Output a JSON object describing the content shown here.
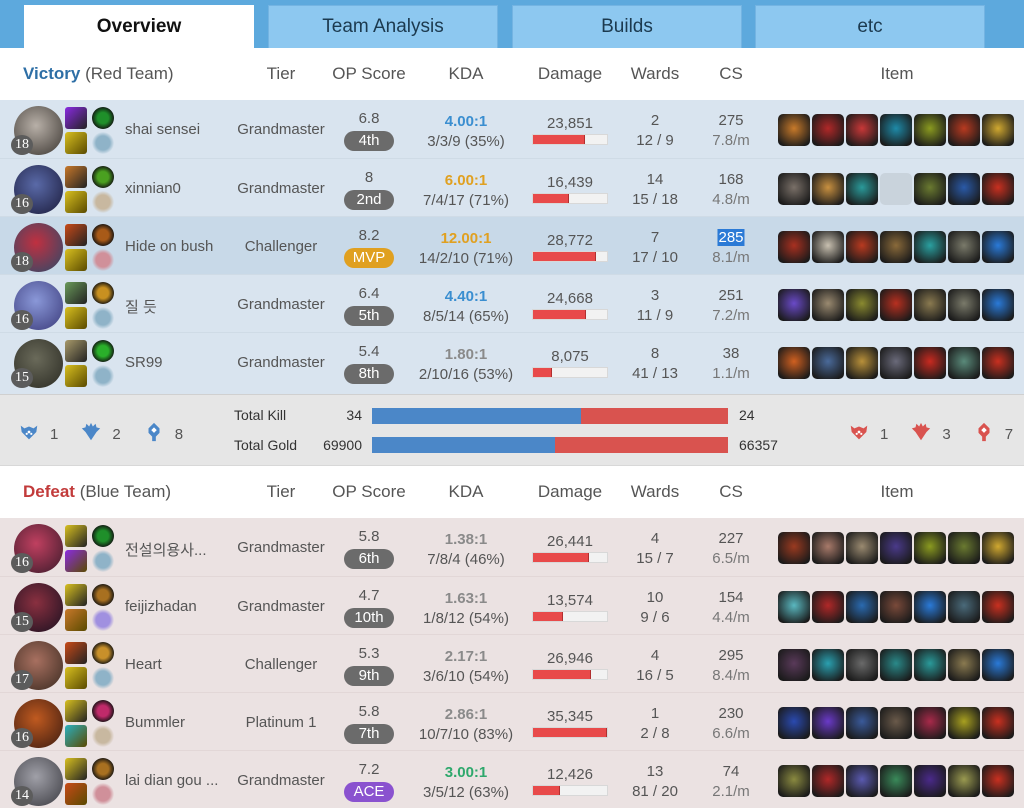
{
  "tabs": [
    {
      "label": "Overview",
      "active": true
    },
    {
      "label": "Team Analysis",
      "active": false
    },
    {
      "label": "Builds",
      "active": false
    },
    {
      "label": "etc",
      "active": false
    }
  ],
  "columns": {
    "tier": "Tier",
    "op_score": "OP Score",
    "kda": "KDA",
    "damage": "Damage",
    "wards": "Wards",
    "cs": "CS",
    "item": "Item"
  },
  "colors": {
    "victory": "#2e6fa6",
    "defeat": "#c23b3b",
    "kda_blue": "#3a8ed0",
    "kda_orange": "#e0a020",
    "kda_green": "#2ea86c",
    "kda_gray": "#8a8a8a",
    "damage_bar": "#e84a4a",
    "mvp": "#e0a020",
    "ace": "#8a52cf",
    "rank": "#6b6b6b",
    "blue_team": "#4b87c8",
    "red_team": "#d9534f"
  },
  "teams": [
    {
      "result": "Victory",
      "team_name": "(Red Team)",
      "players": [
        {
          "name": "shai sensei",
          "level": "18",
          "tier": "Grandmaster",
          "op_score": "6.8",
          "rank": "4th",
          "rank_type": "normal",
          "kda_ratio": "4.00:1",
          "kda_color": "blue",
          "kda_detail": "3/3/9 (35%)",
          "damage": "23,851",
          "damage_fraction": 0.7,
          "wards_placed": "2",
          "wards_detail": "12 / 9",
          "cs": "275",
          "cs_per_min": "7.8/m",
          "highlighted": false,
          "cs_selected": false,
          "avatar_colors": [
            "#b8b0a8",
            "#3a3530"
          ],
          "spells": [
            "#8a2be2",
            "#d8c020"
          ],
          "runes": [
            "#1f8f2a",
            "#8fb3c8"
          ],
          "items": [
            "#c87a2a",
            "#b02828",
            "#c83838",
            "#1e8aa8",
            "#8a9a20",
            "#b83a20",
            "#d0a830"
          ]
        },
        {
          "name": "xinnian0",
          "level": "16",
          "tier": "Grandmaster",
          "op_score": "8",
          "rank": "2nd",
          "rank_type": "normal",
          "kda_ratio": "6.00:1",
          "kda_color": "orange",
          "kda_detail": "7/4/17 (71%)",
          "damage": "16,439",
          "damage_fraction": 0.48,
          "wards_placed": "14",
          "wards_detail": "15 / 18",
          "cs": "168",
          "cs_per_min": "4.8/m",
          "highlighted": false,
          "cs_selected": false,
          "avatar_colors": [
            "#5a6aa8",
            "#1a1a3a"
          ],
          "spells": [
            "#c8782a",
            "#d8c020"
          ],
          "runes": [
            "#4aa020",
            "#c8b8a0"
          ],
          "items": [
            "#7a7068",
            "#c89040",
            "#2a9a9a",
            null,
            "#6a7a30",
            "#2a5aa8",
            "#c83020"
          ]
        },
        {
          "name": "Hide on bush",
          "level": "18",
          "tier": "Challenger",
          "op_score": "8.2",
          "rank": "MVP",
          "rank_type": "mvp",
          "kda_ratio": "12.00:1",
          "kda_color": "orange",
          "kda_detail": "14/2/10 (71%)",
          "damage": "28,772",
          "damage_fraction": 0.85,
          "wards_placed": "7",
          "wards_detail": "17 / 10",
          "cs": "285",
          "cs_per_min": "8.1/m",
          "highlighted": true,
          "cs_selected": true,
          "avatar_colors": [
            "#c03040",
            "#2a4a6a"
          ],
          "spells": [
            "#c84a18",
            "#d8c020"
          ],
          "runes": [
            "#a85a18",
            "#d0909a"
          ],
          "items": [
            "#a83020",
            "#c8c0b0",
            "#b83a20",
            "#8a6a3a",
            "#2aa0a0",
            "#7a7a6a",
            "#2a7ad8"
          ]
        },
        {
          "name": "질 듯",
          "level": "16",
          "tier": "Grandmaster",
          "op_score": "6.4",
          "rank": "5th",
          "rank_type": "normal",
          "kda_ratio": "4.40:1",
          "kda_color": "blue",
          "kda_detail": "8/5/14 (65%)",
          "damage": "24,668",
          "damage_fraction": 0.72,
          "wards_placed": "3",
          "wards_detail": "11 / 9",
          "cs": "251",
          "cs_per_min": "7.2/m",
          "highlighted": false,
          "cs_selected": false,
          "avatar_colors": [
            "#8a98d8",
            "#3a3a7a"
          ],
          "spells": [
            "#6a9a5a",
            "#d8c020"
          ],
          "runes": [
            "#c89020",
            "#8fb3c8"
          ],
          "items": [
            "#6a4ac8",
            "#9a8a70",
            "#8a8a30",
            "#b83020",
            "#8a7a50",
            "#7a7a6a",
            "#2a7ad8"
          ]
        },
        {
          "name": "SR99",
          "level": "15",
          "tier": "Grandmaster",
          "op_score": "5.4",
          "rank": "8th",
          "rank_type": "normal",
          "kda_ratio": "1.80:1",
          "kda_color": "gray",
          "kda_detail": "2/10/16 (53%)",
          "damage": "8,075",
          "damage_fraction": 0.25,
          "wards_placed": "8",
          "wards_detail": "41 / 13",
          "cs": "38",
          "cs_per_min": "1.1/m",
          "highlighted": false,
          "cs_selected": false,
          "avatar_colors": [
            "#6a6a5a",
            "#2a2a22"
          ],
          "spells": [
            "#a89a6a",
            "#d8c020"
          ],
          "runes": [
            "#2ab02a",
            "#8fb3c8"
          ],
          "items": [
            "#d06020",
            "#4a6a9a",
            "#b8903a",
            "#6a6a7a",
            "#c82a20",
            "#5a8a7a",
            "#c83020"
          ]
        }
      ],
      "objectives": [
        {
          "icon": "baron-icon",
          "count": "1"
        },
        {
          "icon": "dragon-icon",
          "count": "2"
        },
        {
          "icon": "tower-icon",
          "count": "8"
        }
      ]
    },
    {
      "result": "Defeat",
      "team_name": "(Blue Team)",
      "players": [
        {
          "name": "전설의용사...",
          "level": "16",
          "tier": "Grandmaster",
          "op_score": "5.8",
          "rank": "6th",
          "rank_type": "normal",
          "kda_ratio": "1.38:1",
          "kda_color": "gray",
          "kda_detail": "7/8/4 (46%)",
          "damage": "26,441",
          "damage_fraction": 0.76,
          "wards_placed": "4",
          "wards_detail": "15 / 7",
          "cs": "227",
          "cs_per_min": "6.5/m",
          "highlighted": false,
          "cs_selected": false,
          "avatar_colors": [
            "#c04060",
            "#3a1a2a"
          ],
          "spells": [
            "#d8c020",
            "#8a2be2"
          ],
          "runes": [
            "#1f8f2a",
            "#8fb3c8"
          ],
          "items": [
            "#9a3a20",
            "#a87a6a",
            "#9a8a70",
            "#4a3a8a",
            "#8a9a20",
            "#6a7a30",
            "#d0a830"
          ]
        },
        {
          "name": "feijizhadan",
          "level": "15",
          "tier": "Grandmaster",
          "op_score": "4.7",
          "rank": "10th",
          "rank_type": "normal",
          "kda_ratio": "1.63:1",
          "kda_color": "gray",
          "kda_detail": "1/8/12 (54%)",
          "damage": "13,574",
          "damage_fraction": 0.4,
          "wards_placed": "10",
          "wards_detail": "9 / 6",
          "cs": "154",
          "cs_per_min": "4.4/m",
          "highlighted": false,
          "cs_selected": false,
          "avatar_colors": [
            "#8a3040",
            "#1a1020"
          ],
          "spells": [
            "#d8c020",
            "#c8782a"
          ],
          "runes": [
            "#a87020",
            "#a090e0"
          ],
          "items": [
            "#5ab8c0",
            "#b02828",
            "#2a6ab0",
            "#7a4a3a",
            "#2a7ad8",
            "#4a6a7a",
            "#c83020"
          ]
        },
        {
          "name": "Heart",
          "level": "17",
          "tier": "Challenger",
          "op_score": "5.3",
          "rank": "9th",
          "rank_type": "normal",
          "kda_ratio": "2.17:1",
          "kda_color": "gray",
          "kda_detail": "3/6/10 (54%)",
          "damage": "26,946",
          "damage_fraction": 0.78,
          "wards_placed": "4",
          "wards_detail": "16 / 5",
          "cs": "295",
          "cs_per_min": "8.4/m",
          "highlighted": false,
          "cs_selected": false,
          "avatar_colors": [
            "#a87060",
            "#3a2a20"
          ],
          "spells": [
            "#c84a18",
            "#d8c020"
          ],
          "runes": [
            "#c8902a",
            "#8fb3c8"
          ],
          "items": [
            "#5a3a5a",
            "#2aa0b0",
            "#6a6a6a",
            "#2a8a8a",
            "#2a9a9a",
            "#8a7a50",
            "#2a7ad8"
          ]
        },
        {
          "name": "Bummler",
          "level": "16",
          "tier": "Platinum 1",
          "op_score": "5.8",
          "rank": "7th",
          "rank_type": "normal",
          "kda_ratio": "2.86:1",
          "kda_color": "gray",
          "kda_detail": "10/7/10 (83%)",
          "damage": "35,345",
          "damage_fraction": 1.0,
          "wards_placed": "1",
          "wards_detail": "2 / 8",
          "cs": "230",
          "cs_per_min": "6.6/m",
          "highlighted": false,
          "cs_selected": false,
          "avatar_colors": [
            "#c05a20",
            "#3a1a10"
          ],
          "spells": [
            "#d8c020",
            "#2ab0c0"
          ],
          "runes": [
            "#c02a6a",
            "#c8b8a0"
          ],
          "items": [
            "#2a4ab0",
            "#6a3ac8",
            "#3a5a9a",
            "#6a5a4a",
            "#a82a4a",
            "#a8a020",
            "#c83020"
          ]
        },
        {
          "name": "lai dian gou ...",
          "level": "14",
          "tier": "Grandmaster",
          "op_score": "7.2",
          "rank": "ACE",
          "rank_type": "ace",
          "kda_ratio": "3.00:1",
          "kda_color": "green",
          "kda_detail": "3/5/12 (63%)",
          "damage": "12,426",
          "damage_fraction": 0.36,
          "wards_placed": "13",
          "wards_detail": "81 / 20",
          "cs": "74",
          "cs_per_min": "2.1/m",
          "highlighted": false,
          "cs_selected": false,
          "avatar_colors": [
            "#a0a0a8",
            "#3a3a40"
          ],
          "spells": [
            "#d8c020",
            "#c84a18"
          ],
          "runes": [
            "#a87020",
            "#d0909a"
          ],
          "items": [
            "#8a8a40",
            "#b02828",
            "#5a5ab0",
            "#3a8a5a",
            "#4a2a8a",
            "#9a9a50",
            "#c83020"
          ]
        }
      ],
      "objectives": [
        {
          "icon": "baron-icon",
          "count": "1"
        },
        {
          "icon": "dragon-icon",
          "count": "3"
        },
        {
          "icon": "tower-icon",
          "count": "7"
        }
      ]
    }
  ],
  "summary": {
    "total_kill_label": "Total Kill",
    "total_gold_label": "Total Gold",
    "kills_red_team": "34",
    "kills_blue_team": "24",
    "gold_red_team": "69900",
    "gold_blue_team": "66357",
    "kill_share_left": 0.586,
    "gold_share_left": 0.513
  }
}
